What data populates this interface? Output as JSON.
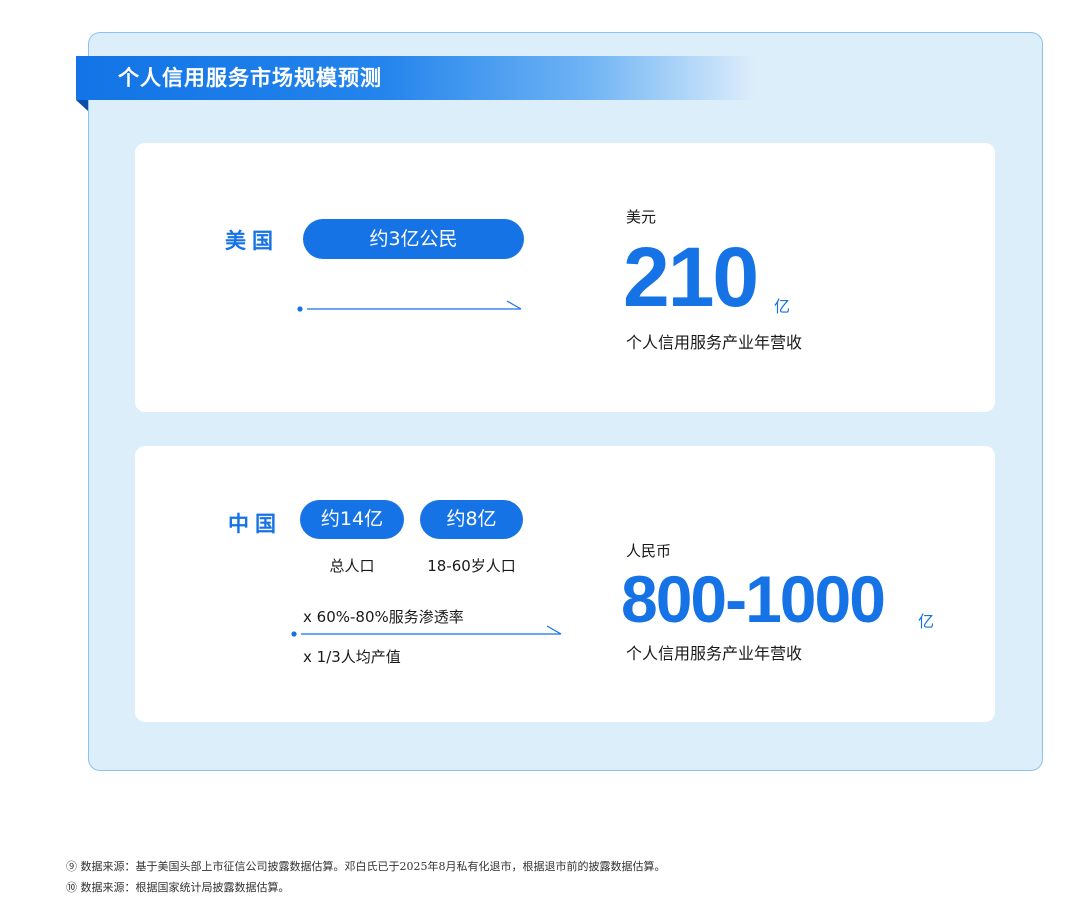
{
  "title": "个人信用服务市场规模预测",
  "us": {
    "country": "美国",
    "pill": "约3亿公民",
    "unit_label": "美元",
    "value": "210",
    "value_unit": "亿",
    "caption": "个人信用服务产业年营收"
  },
  "cn": {
    "country": "中国",
    "pill_total": "约14亿",
    "pill_total_label": "总人口",
    "pill_working": "约8亿",
    "pill_working_label": "18-60岁人口",
    "factor_penetration": "x 60%-80%服务渗透率",
    "factor_output": "x 1/3人均产值",
    "unit_label": "人民币",
    "value": "800-1000",
    "value_unit": "亿",
    "caption": "个人信用服务产业年营收"
  },
  "footnotes": [
    "⑨ 数据来源：基于美国头部上市征信公司披露数据估算。邓白氏已于2025年8月私有化退市，根据退市前的披露数据估算。",
    "⑩ 数据来源：根据国家统计局披露数据估算。"
  ],
  "colors": {
    "accent": "#1573e6",
    "panel_bg": "#ddeefb",
    "panel_border": "#8cc2ee"
  }
}
